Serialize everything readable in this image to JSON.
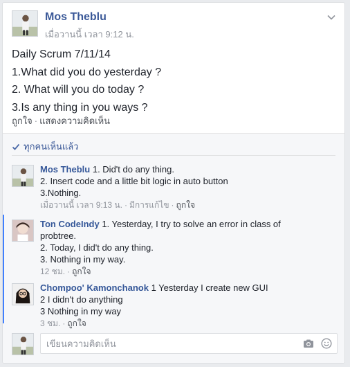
{
  "post": {
    "author": "Mos Theblu",
    "time": "เมื่อวานนี้ เวลา 9:12 น.",
    "body": [
      "Daily Scrum 7/11/14",
      "1.What did you do yesterday ?",
      "2. What will you do today ?",
      "3.Is any thing in you ways ?"
    ],
    "like_label": "ถูกใจ",
    "comment_label": "แสดงความคิดเห็น",
    "separator": "·"
  },
  "seen": {
    "label": "ทุกคนเห็นแล้ว"
  },
  "comments": [
    {
      "author": "Mos Theblu",
      "lines": [
        "1. Did't do any thing.",
        "2. Insert code and a little bit logic in auto button",
        "3.Nothing."
      ],
      "time": "เมื่อวานนี้ เวลา 9:13 น.",
      "edited": "มีการแก้ไข",
      "like": "ถูกใจ"
    },
    {
      "author": "Ton CodeIndy",
      "lines": [
        "1. Yesterday, I try to solve an error in class of",
        "probtree.",
        "2. Today, I did't do any thing.",
        "3. Nothing in my way."
      ],
      "time": "12 ชม.",
      "like": "ถูกใจ"
    },
    {
      "author": "Chompoo' Kamonchanok",
      "lines": [
        "1 Yesterday I create new GUI",
        "2 I didn't do anything",
        "3 Nothing in my way"
      ],
      "time": "3 ชม.",
      "like": "ถูกใจ"
    }
  ],
  "compose": {
    "placeholder": "เขียนความคิดเห็น"
  },
  "icons": {
    "chevron": "chevron-down-icon",
    "check": "check-icon",
    "camera": "camera-icon",
    "emoji": "emoji-icon"
  },
  "colors": {
    "link": "#3b5998",
    "accent": "#4080ff",
    "meta": "#90949c"
  }
}
